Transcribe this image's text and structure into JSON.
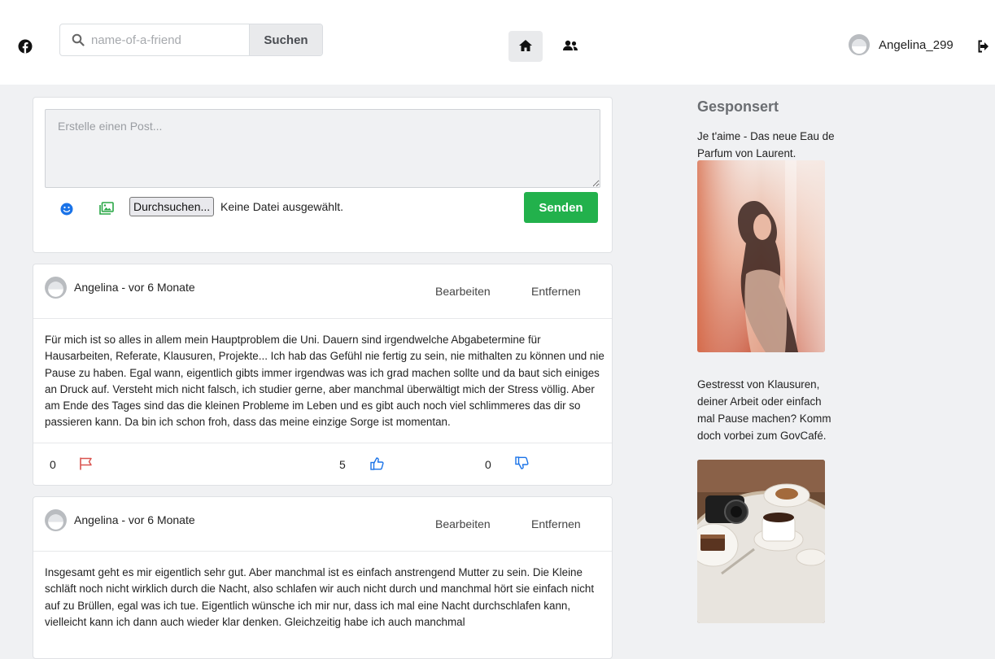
{
  "header": {
    "search": {
      "placeholder": "name-of-a-friend",
      "value": "",
      "button_label": "Suchen"
    },
    "user": {
      "name": "Angelina_299"
    }
  },
  "composer": {
    "placeholder": "Erstelle einen Post...",
    "browse_label": "Durchsuchen...",
    "file_status": "Keine Datei ausgewählt.",
    "send_label": "Senden"
  },
  "posts": [
    {
      "author_line": "Angelina - vor 6 Monate",
      "edit_label": "Bearbeiten",
      "delete_label": "Entfernen",
      "text": "Für mich ist so alles in allem mein Hauptproblem die Uni. Dauern sind irgendwelche Abgabetermine für Hausarbeiten, Referate, Klausuren, Projekte... Ich hab das Gefühl nie fertig zu sein, nie mithalten zu können und nie Pause zu haben. Egal wann, eigentlich gibts immer irgendwas was ich grad machen sollte und da baut sich einiges an Druck auf. Versteht mich nicht falsch, ich studier gerne, aber manchmal überwältigt mich der Stress völlig. Aber am Ende des Tages sind das die kleinen Probleme im Leben und es gibt auch noch viel schlimmeres das dir so passieren kann. Da bin ich schon froh, dass das meine einzige Sorge ist momentan.",
      "flags": "0",
      "likes": "5",
      "dislikes": "0"
    },
    {
      "author_line": "Angelina - vor 6 Monate",
      "edit_label": "Bearbeiten",
      "delete_label": "Entfernen",
      "text": "Insgesamt geht es mir eigentlich sehr gut. Aber manchmal ist es einfach anstrengend Mutter zu sein. Die Kleine schläft noch nicht wirklich durch die Nacht, also schlafen wir auch nicht durch und manchmal hört sie einfach nicht auf zu Brüllen, egal was ich tue. Eigentlich wünsche ich mir nur, dass ich mal eine Nacht durchschlafen kann, vielleicht kann ich dann auch wieder klar denken. Gleichzeitig habe ich auch manchmal"
    }
  ],
  "sidebar": {
    "title": "Gesponsert",
    "ads": [
      {
        "text": "Je t'aime - Das neue Eau de Parfum von Laurent."
      },
      {
        "text": "Gestresst von Klausuren, deiner Arbeit oder einfach mal Pause machen? Komm doch vorbei zum GovCafé."
      }
    ]
  },
  "colors": {
    "send_button": "#22b14c",
    "flag_icon": "#d9534f",
    "vote_icons": "#1a73e8",
    "emoji_icon": "#1a73e8",
    "image_icon": "#28a745"
  }
}
